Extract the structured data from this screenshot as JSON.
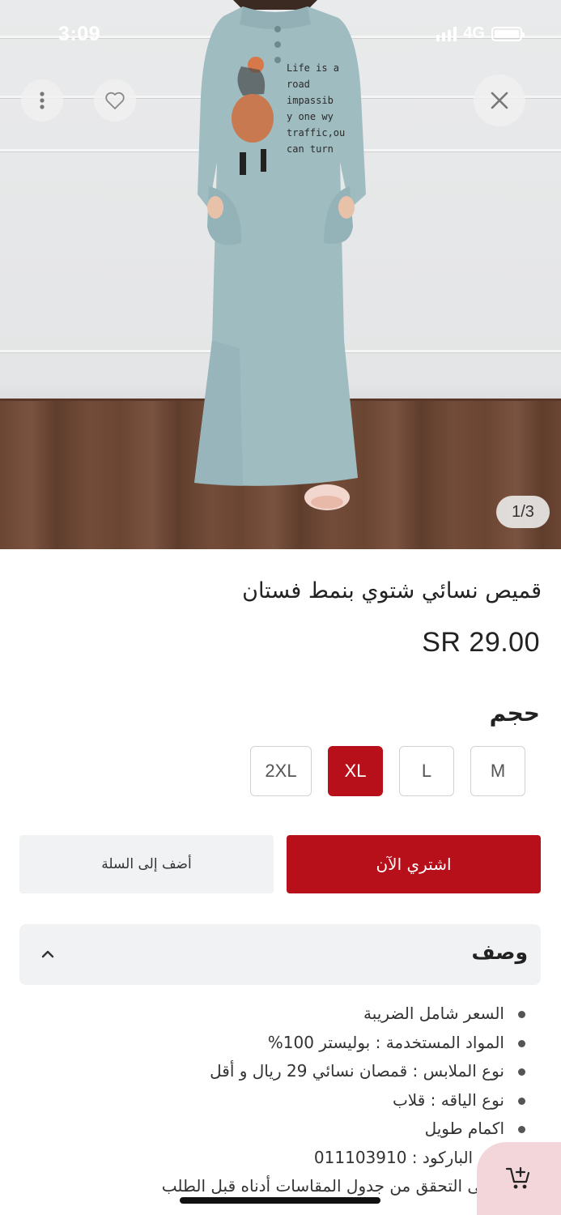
{
  "status": {
    "time": "3:09",
    "network": "4G"
  },
  "gallery": {
    "counter": "1/3",
    "print_lines": [
      "Life is a",
      "road",
      "impassib",
      "y one wy",
      "traffic,ou",
      "can turn"
    ]
  },
  "product": {
    "title": "قميص نسائي شتوي بنمط فستان",
    "price": "SR 29.00"
  },
  "size": {
    "heading": "حجم",
    "options": [
      "M",
      "L",
      "XL",
      "2XL"
    ],
    "selected": "XL"
  },
  "actions": {
    "buy_now": "اشتري الآن",
    "add_to_cart": "أضف إلى السلة"
  },
  "description": {
    "title": "وصف",
    "items": [
      "السعر شامل الضريبة",
      "المواد المستخدمة : بوليستر 100%",
      "نوع الملابس : قمصان نسائي 29 ريال و أقل",
      "نوع الياقه : قلاب",
      "اكمام طويل",
      "رقم الباركود : 011103910",
      "يرجى التحقق من جدول المقاسات أدناه قبل الطلب"
    ]
  },
  "colors": {
    "accent": "#b7101b",
    "dress": "#9fbcc1",
    "fab_bg": "#f3d6da"
  },
  "icons": [
    "more-vertical-icon",
    "heart-icon",
    "close-icon",
    "chevron-up-icon",
    "add-to-cart-icon"
  ]
}
